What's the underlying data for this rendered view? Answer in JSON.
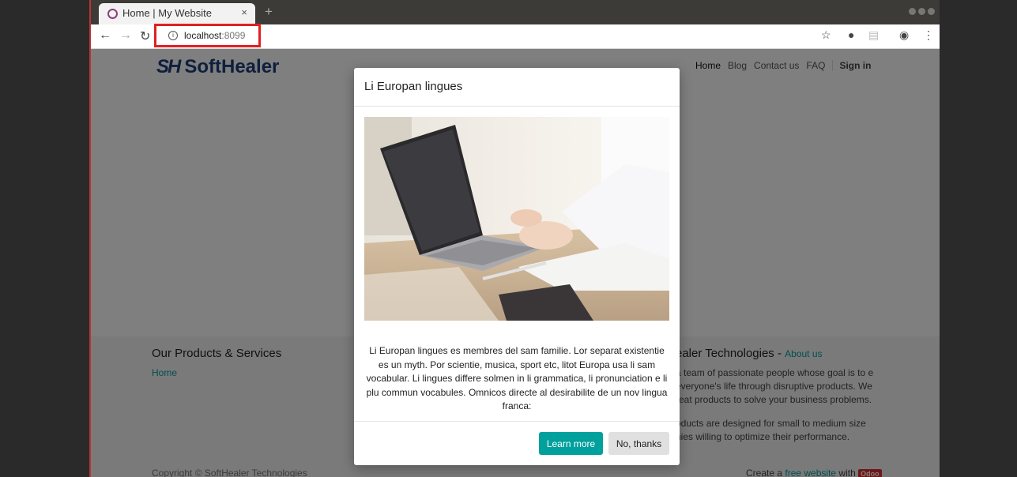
{
  "browser": {
    "tab_title": "Home | My Website",
    "tab_close": "×",
    "new_tab": "+",
    "url_host": "localhost",
    "url_port": ":8099"
  },
  "site": {
    "logo_mark": "SH",
    "logo_text": "SoftHealer",
    "nav": [
      "Home",
      "Blog",
      "Contact us",
      "FAQ",
      "Sign in"
    ]
  },
  "footer": {
    "products_title": "Our Products & Services",
    "products_link": "Home",
    "about_title": "ealer Technologies",
    "about_link": "About us",
    "about_p1": "a team of passionate people whose goal is to e everyone's life through disruptive products. We reat products to solve your business problems.",
    "about_p2": "oducts are designed for small to medium size nies willing to optimize their performance.",
    "copyright": "Copyright © SoftHealer Technologies",
    "create_prefix": "Create a",
    "create_link": "free website",
    "create_with": "with",
    "odoo": "Odoo"
  },
  "modal": {
    "title": "Li Europan lingues",
    "body": "Li Europan lingues es membres del sam familie. Lor separat existentie es un myth. Por scientie, musica, sport etc, litot Europa usa li sam vocabular. Li lingues differe solmen in li grammatica, li pronunciation e li plu commun vocabules. Omnicos directe al desirabilite de un nov lingua franca:",
    "learn_more": "Learn more",
    "no_thanks": "No, thanks"
  }
}
